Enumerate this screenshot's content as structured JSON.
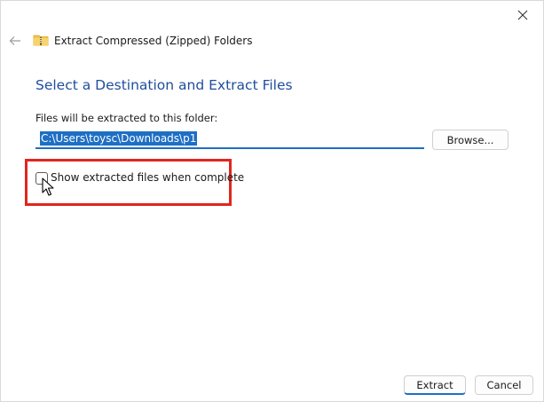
{
  "window": {
    "title": "Extract Compressed (Zipped) Folders"
  },
  "main": {
    "heading": "Select a Destination and Extract Files",
    "path_label": "Files will be extracted to this folder:",
    "path_value": "C:\\Users\\toysc\\Downloads\\p1",
    "browse_label": "Browse...",
    "show_files_label": "Show extracted files when complete",
    "show_files_checked": false
  },
  "footer": {
    "extract_label": "Extract",
    "cancel_label": "Cancel"
  },
  "colors": {
    "heading": "#1f4e9c",
    "accent": "#1e6fc4",
    "highlight": "#e0261f"
  },
  "icons": {
    "back": "arrow-left-icon",
    "close": "close-icon",
    "app": "zip-folder-icon",
    "cursor": "mouse-pointer-icon"
  }
}
